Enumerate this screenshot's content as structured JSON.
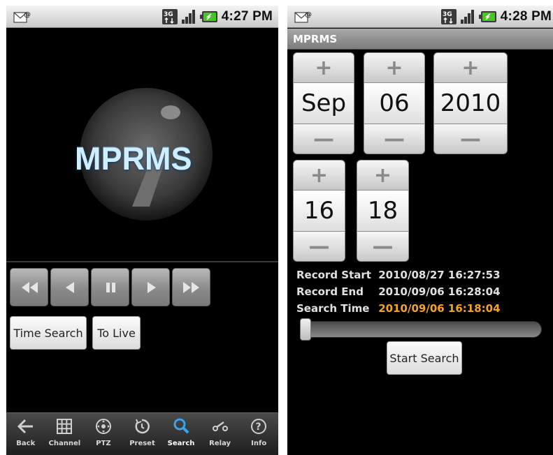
{
  "left_phone": {
    "status": {
      "time": "4:27 PM"
    },
    "logo": {
      "text": "MPRMS"
    },
    "controls": {
      "items": [
        "rewind-icon",
        "step-back-icon",
        "pause-icon",
        "play-icon",
        "fast-forward-icon"
      ]
    },
    "buttons": {
      "time_search": "Time Search",
      "to_live": "To Live"
    },
    "nav": [
      {
        "label": "Back",
        "icon": "back-arrow-icon"
      },
      {
        "label": "Channel",
        "icon": "grid-icon"
      },
      {
        "label": "PTZ",
        "icon": "ptz-icon"
      },
      {
        "label": "Preset",
        "icon": "preset-icon"
      },
      {
        "label": "Search",
        "icon": "search-icon",
        "active": true
      },
      {
        "label": "Relay",
        "icon": "relay-icon"
      },
      {
        "label": "Info",
        "icon": "info-icon"
      }
    ]
  },
  "right_phone": {
    "status": {
      "time": "4:28 PM"
    },
    "title": "MPRMS",
    "date_pickers": {
      "month": "Sep",
      "day": "06",
      "year": "2010"
    },
    "time_pickers": {
      "hour": "16",
      "minute": "18"
    },
    "plus_symbol": "+",
    "minus_symbol": "—",
    "info": {
      "record_start_label": "Record Start",
      "record_start_value": "2010/08/27 16:27:53",
      "record_end_label": "Record End",
      "record_end_value": "2010/09/06 16:28:04",
      "search_time_label": "Search Time",
      "search_time_value": "2010/09/06 16:18:04"
    },
    "slider_value": 0,
    "start_search": "Start Search"
  },
  "colors": {
    "accent_blue": "#39a4ec",
    "search_time_orange": "#f5a325"
  }
}
